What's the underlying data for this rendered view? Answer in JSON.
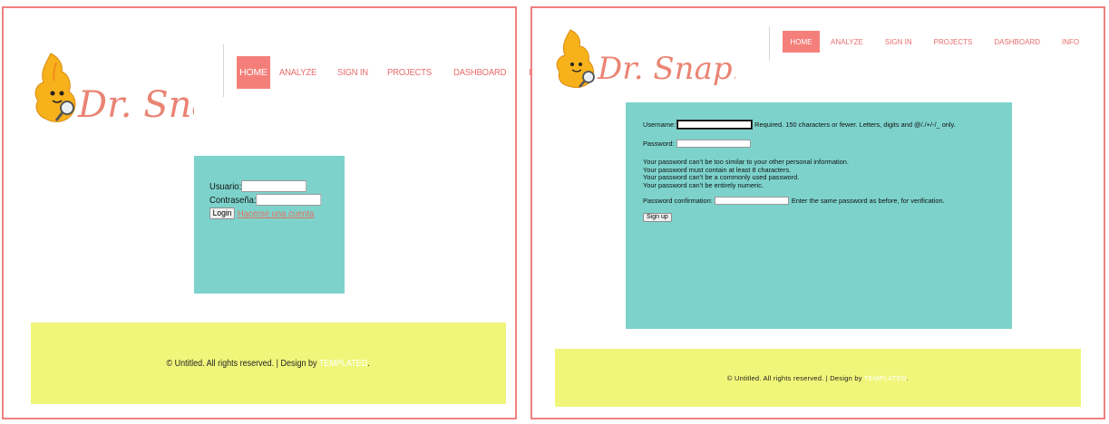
{
  "brand": {
    "name": "Dr. Snap!",
    "colors": {
      "accent": "#f47f7a",
      "nav_text": "#e86c6c",
      "form_bg": "#7dd3cc",
      "footer_bg": "#f0f67a",
      "frame": "#f08080"
    },
    "logo_icon": "fire-mascot-with-magnifier-icon"
  },
  "nav": {
    "items": [
      {
        "label": "HOME",
        "active": true
      },
      {
        "label": "ANALYZE"
      },
      {
        "label": "SIGN IN"
      },
      {
        "label": "PROJECTS"
      },
      {
        "label": "DASHBOARD"
      },
      {
        "label": "INFO"
      }
    ]
  },
  "login": {
    "username_label": "Usuario:",
    "password_label": "Contraseña:",
    "login_button": "Login",
    "register_link": "Hacerse una cuenta",
    "username_value": "",
    "password_value": ""
  },
  "signup": {
    "username_label": "Username:",
    "username_help": "Required. 150 characters or fewer. Letters, digits and @/./+/-/_ only.",
    "password_label": "Password:",
    "password_rules": [
      "Your password can’t be too similar to your other personal information.",
      "Your password must contain at least 8 characters.",
      "Your password can’t be a commonly used password.",
      "Your password can’t be entirely numeric."
    ],
    "confirm_label": "Password confirmation:",
    "confirm_help": "Enter the same password as before, for verification.",
    "submit_button": "Sign up"
  },
  "footer": {
    "text": "© Untitled. All rights reserved. | Design by",
    "credit": "TEMPLATED",
    "end": "."
  }
}
